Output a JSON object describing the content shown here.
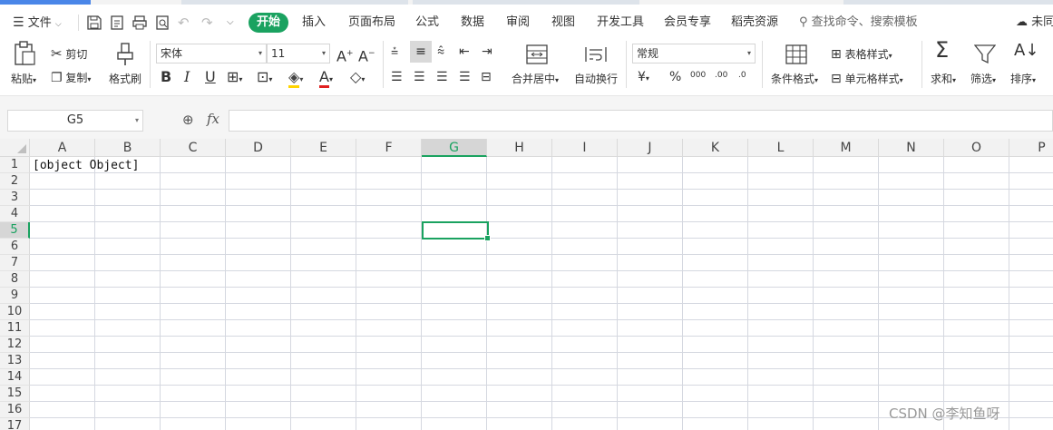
{
  "menubar": {
    "file_label": "文件",
    "tabs": [
      "开始",
      "插入",
      "页面布局",
      "公式",
      "数据",
      "审阅",
      "视图",
      "开发工具",
      "会员专享",
      "稻壳资源"
    ],
    "search_placeholder": "查找命令、搜索模板",
    "sync_status": "未同"
  },
  "ribbon": {
    "paste": "粘贴",
    "cut": "剪切",
    "copy": "复制",
    "format_painter": "格式刷",
    "font_name": "宋体",
    "font_size": "11",
    "merge_center": "合并居中",
    "wrap_text": "自动换行",
    "number_format": "常规",
    "conditional_format": "条件格式",
    "table_style": "表格样式",
    "cell_style": "单元格样式",
    "sum": "求和",
    "filter": "筛选",
    "sort": "排序",
    "currency_symbol": "¥",
    "percent_symbol": "%",
    "thousands_symbol": "000",
    "dec_increase": ".00",
    "dec_decrease": ".0"
  },
  "formula_bar": {
    "name_box": "G5",
    "fx_label": "fx",
    "content": ""
  },
  "sheet": {
    "columns": [
      "A",
      "B",
      "C",
      "D",
      "E",
      "F",
      "G",
      "H",
      "I",
      "J",
      "K",
      "L",
      "M",
      "N",
      "O",
      "P"
    ],
    "rows": [
      "1",
      "2",
      "3",
      "4",
      "5",
      "6",
      "7",
      "8",
      "9",
      "10",
      "11",
      "12",
      "13",
      "14",
      "15",
      "16",
      "17"
    ],
    "cell_a1": "[object Object]",
    "active_cell": "G5"
  },
  "watermark": "CSDN @李知鱼呀",
  "colors": {
    "accent": "#1aa260",
    "gridline": "#d5d8e0"
  }
}
